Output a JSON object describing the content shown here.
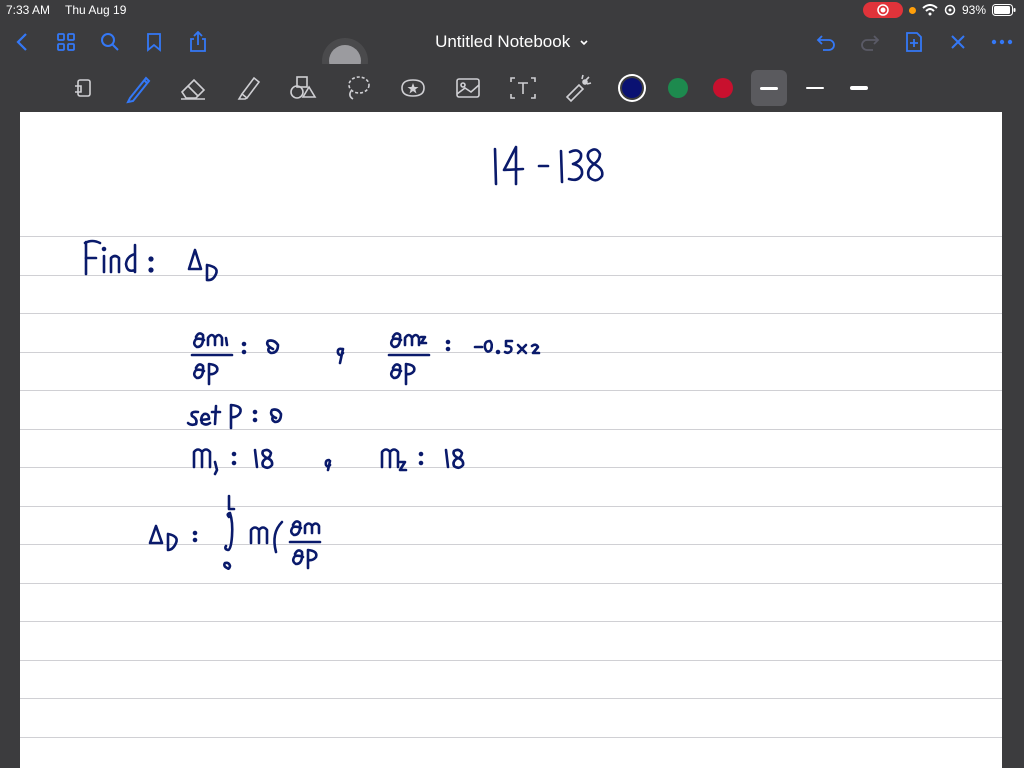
{
  "status": {
    "time": "7:33 AM",
    "date": "Thu Aug 19",
    "battery": "93%"
  },
  "nav": {
    "title": "Untitled Notebook"
  },
  "colors": {
    "accent": "#3478f6",
    "ink": "#0a1a6b",
    "pen_blue": "#0a1172",
    "pen_green": "#1d8a4e",
    "pen_red": "#c8102e"
  },
  "icons": [
    "back-icon",
    "grid-icon",
    "search-icon",
    "bookmark-icon",
    "share-icon",
    "undo-icon",
    "redo-icon",
    "add-page-icon",
    "close-icon",
    "more-icon",
    "lasso-tool-icon",
    "pen-icon",
    "eraser-icon",
    "highlighter-icon",
    "shapes-icon",
    "lasso-select-icon",
    "sticker-icon",
    "image-icon",
    "text-icon",
    "laser-icon"
  ],
  "note": {
    "heading": "14 - 138",
    "find_label": "Find :",
    "find_target": "ΔD",
    "line_partials": "∂m₁/∂P = 0 , ∂m₂/∂P = −0.5x₂",
    "line_set": "set P = 0",
    "line_moments": "m₁ = 18 , m₂ = 18",
    "line_integral": "ΔD = ∫₀ᴸ m (∂m/∂P"
  }
}
